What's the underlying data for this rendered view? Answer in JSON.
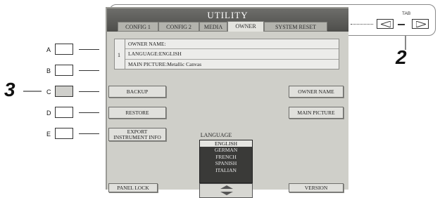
{
  "utility": {
    "title": "UTILITY",
    "tabs": [
      "CONFIG 1",
      "CONFIG 2",
      "MEDIA",
      "OWNER",
      "SYSTEM RESET"
    ],
    "active_tab": "OWNER"
  },
  "owner_info": {
    "row_number": "1",
    "lines": [
      "OWNER NAME:",
      "LANGUAGE:ENGLISH",
      "MAIN PICTURE:Metallic Canvas"
    ]
  },
  "left_buttons": {
    "backup": "BACKUP",
    "restore": "RESTORE",
    "export_line1": "EXPORT",
    "export_line2": "INSTRUMENT INFO",
    "panel_lock": "PANEL LOCK"
  },
  "right_buttons": {
    "owner_name": "OWNER NAME",
    "main_picture": "MAIN PICTURE",
    "version": "VERSION"
  },
  "language": {
    "label": "LANGUAGE",
    "options": [
      "ENGLISH",
      "GERMAN",
      "FRENCH",
      "SPANISH",
      "ITALIAN"
    ],
    "selected": "ENGLISH"
  },
  "panel_buttons": [
    "A",
    "B",
    "C",
    "D",
    "E"
  ],
  "pressed_panel_button": "C",
  "steps": {
    "tab_step": "2",
    "button_step": "3"
  },
  "tab_caption": "TAB",
  "colors": {
    "screen_bg": "#cfcfc9",
    "title_bar": "#5a5a57",
    "list_bg": "#3a3a38"
  }
}
